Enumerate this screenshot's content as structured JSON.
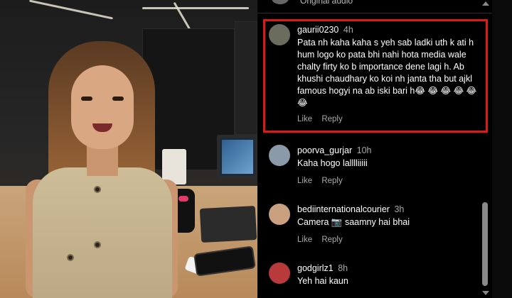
{
  "header": {
    "audio_label": "Original audio"
  },
  "comments": [
    {
      "username": "gaurii0230",
      "time": "4h",
      "text": "Pata nh kaha kaha s yeh sab ladki uth k ati h hum logo ko pata bhi nahi hota media wale chalty firty ko b importance dene lagi h. Ab khushi chaudhary ko koi nh janta tha but ajkl famous hogyi na ab iski bari h😂 😂 😂 😂 😂 😂",
      "like": "Like",
      "reply": "Reply",
      "avatar_color": "#6b6b5e"
    },
    {
      "username": "poorva_gurjar",
      "time": "10h",
      "text": "Kaha hogo lalllliiiii",
      "like": "Like",
      "reply": "Reply",
      "avatar_color": "#8a9aa8"
    },
    {
      "username": "bediinternationalcourier",
      "time": "3h",
      "text": "Camera 📷 saamny hai bhai",
      "like": "Like",
      "reply": "Reply",
      "avatar_color": "#c9a080"
    },
    {
      "username": "godgirlz1",
      "time": "8h",
      "text": "Yeh hai kaun",
      "like": "Like",
      "reply": "Reply",
      "avatar_color": "#b83a3a"
    }
  ],
  "colors": {
    "highlight": "#e01818",
    "muted": "#a8a8a8",
    "background": "#000000"
  }
}
